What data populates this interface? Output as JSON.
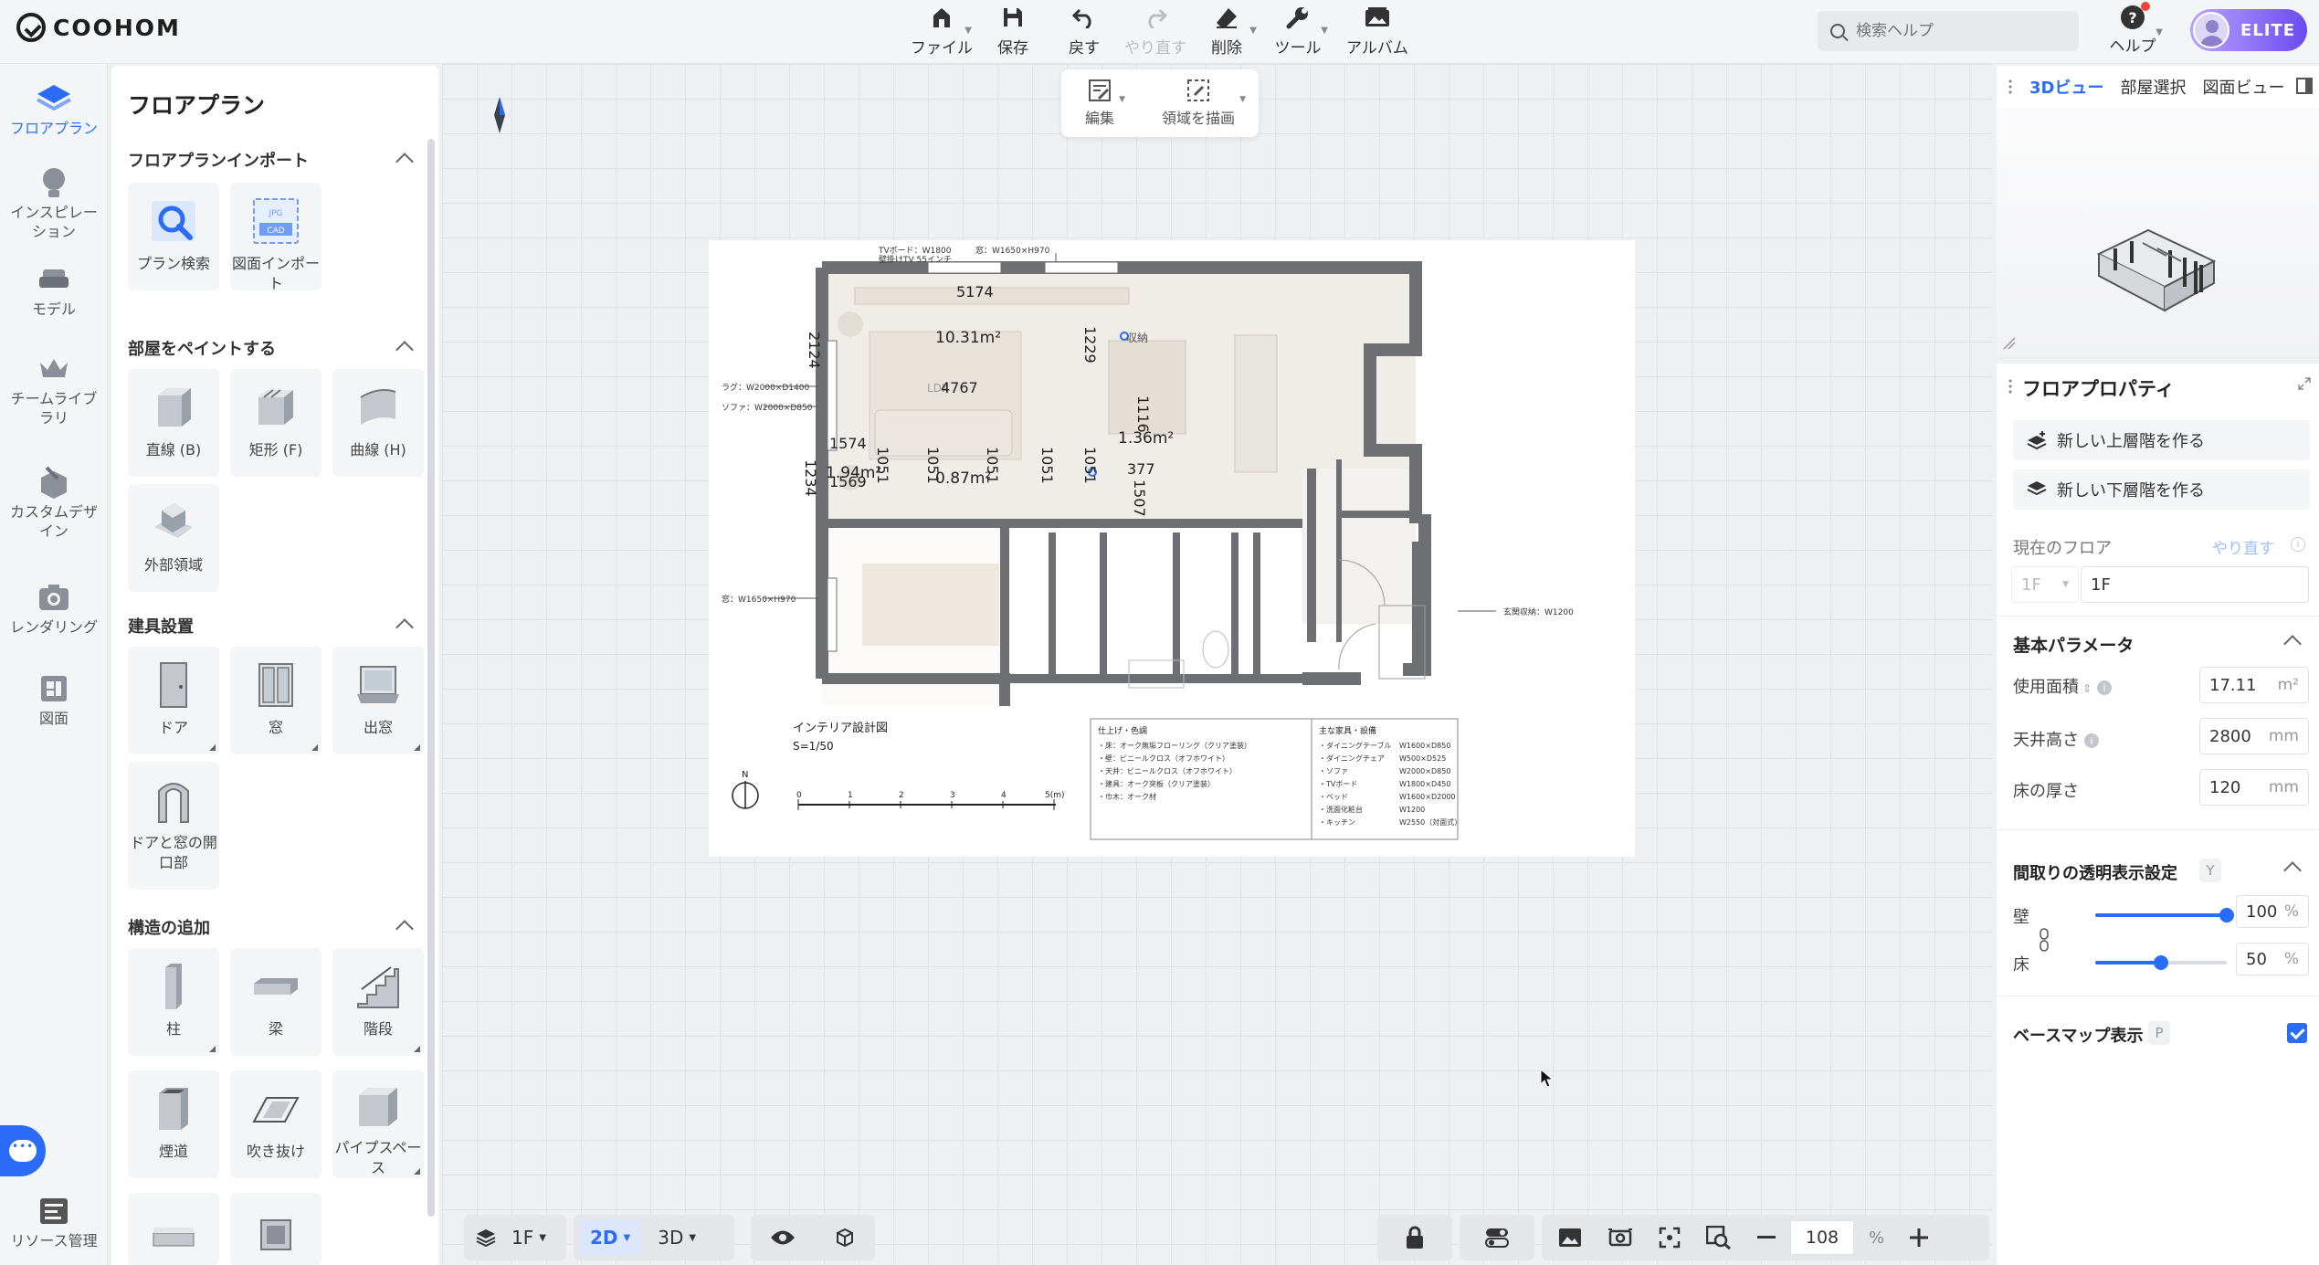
{
  "brand": "COOHOM",
  "toolbar": {
    "file": "ファイル",
    "save": "保存",
    "undo": "戻す",
    "redo": "やり直す",
    "delete": "削除",
    "tools": "ツール",
    "album": "アルバム"
  },
  "search": {
    "placeholder": "検索ヘルプ"
  },
  "help": "ヘルプ",
  "plan_badge": "ELITE",
  "rail": [
    {
      "label": "フロアプラン"
    },
    {
      "label": "インスピレーション"
    },
    {
      "label": "モデル"
    },
    {
      "label": "チームライブラリ"
    },
    {
      "label": "カスタムデザイン"
    },
    {
      "label": "レンダリング"
    },
    {
      "label": "図面"
    },
    {
      "label": "リソース管理"
    }
  ],
  "panel": {
    "title": "フロアプラン",
    "import": {
      "title": "フロアプランインポート",
      "items": [
        "プラン検索",
        "図面インポート"
      ]
    },
    "paint": {
      "title": "部屋をペイントする",
      "items": [
        "直線 (B)",
        "矩形 (F)",
        "曲線 (H)",
        "外部領域"
      ]
    },
    "fixtures": {
      "title": "建具設置",
      "items": [
        "ドア",
        "窓",
        "出窓",
        "ドアと窓の開口部"
      ]
    },
    "structure": {
      "title": "構造の追加",
      "items": [
        "柱",
        "梁",
        "階段",
        "煙道",
        "吹き抜け",
        "パイプスペース"
      ]
    }
  },
  "canvas_toolbar": {
    "edit": "編集",
    "draw_area": "領域を描画"
  },
  "plan": {
    "drawing_title": "インテリア設計図",
    "scale": "S=1/50",
    "north": "N",
    "scale_ticks": [
      "0",
      "1",
      "2",
      "3",
      "4",
      "5(m)"
    ],
    "dims": {
      "top": "5174",
      "ldk_area": "10.31m²",
      "ldk_w": "4767",
      "left": "2124",
      "right": "1229",
      "bed_w1": "1574",
      "bed_area": "1.94m²",
      "bed_w2": "1569",
      "bed_h": "1234",
      "hall_area": "0.87m²",
      "storage_area": "1.36m²",
      "v1116": "1116",
      "v1051": "1051",
      "v1507": "1507",
      "v377": "377",
      "ldk_label": "LDK",
      "storage_label": "収納"
    },
    "annotations": {
      "tv": "TVボード：W1800",
      "tv2": "壁掛けTV 55インチ",
      "win_top": "窓：W1650×H970",
      "rug": "ラグ：W2000×D1400",
      "sofa": "ソファ：W2000×D850",
      "win_left": "窓：W1650×H970",
      "shoes": "玄関収納：W1200"
    },
    "finish_title": "仕上げ・色調",
    "finish": [
      "・床：オーク無垢フローリング（クリア塗装）",
      "・壁：ビニールクロス（オフホワイト）",
      "・天井：ビニールクロス（オフホワイト）",
      "・建具：オーク突板（クリア塗装）",
      "・巾木：オーク材"
    ],
    "furniture_title": "主な家具・設備",
    "furniture": [
      [
        "・ダイニングテーブル",
        "W1600×D850"
      ],
      [
        "・ダイニングチェア",
        "W500×D525"
      ],
      [
        "・ソファ",
        "W2000×D850"
      ],
      [
        "・TVボード",
        "W1800×D450"
      ],
      [
        "・ベッド",
        "W1600×D2000"
      ],
      [
        "・洗面化粧台",
        "W1200"
      ],
      [
        "・キッチン",
        "W2550（対面式）"
      ]
    ]
  },
  "bottom": {
    "floor": "1F",
    "view2d": "2D",
    "view3d": "3D",
    "zoom": "108",
    "zoom_unit": "%"
  },
  "right_tabs": [
    "3Dビュー",
    "部屋選択",
    "図面ビュー"
  ],
  "props": {
    "title": "フロアプロパティ",
    "add_upper": "新しい上層階を作る",
    "add_lower": "新しい下層階を作る",
    "current_floor_label": "現在のフロア",
    "redo": "やり直す",
    "floor_select": "1F",
    "floor_name": "1F",
    "basic_title": "基本パラメータ",
    "area_label": "使用面積",
    "area_value": "17.11",
    "area_unit": "m²",
    "ceiling_label": "天井高さ",
    "ceiling_value": "2800",
    "ceiling_unit": "mm",
    "floor_thick_label": "床の厚さ",
    "floor_thick_value": "120",
    "floor_thick_unit": "mm",
    "transparency_title": "間取りの透明表示設定",
    "transparency_key": "Y",
    "wall_label": "壁",
    "wall_value": "100",
    "wall_opacity": 1.0,
    "floor_label": "床",
    "floor_value": "50",
    "floor_opacity": 0.5,
    "pct": "%",
    "basemap_label": "ベースマップ表示",
    "basemap_key": "P",
    "basemap_checked": true
  }
}
